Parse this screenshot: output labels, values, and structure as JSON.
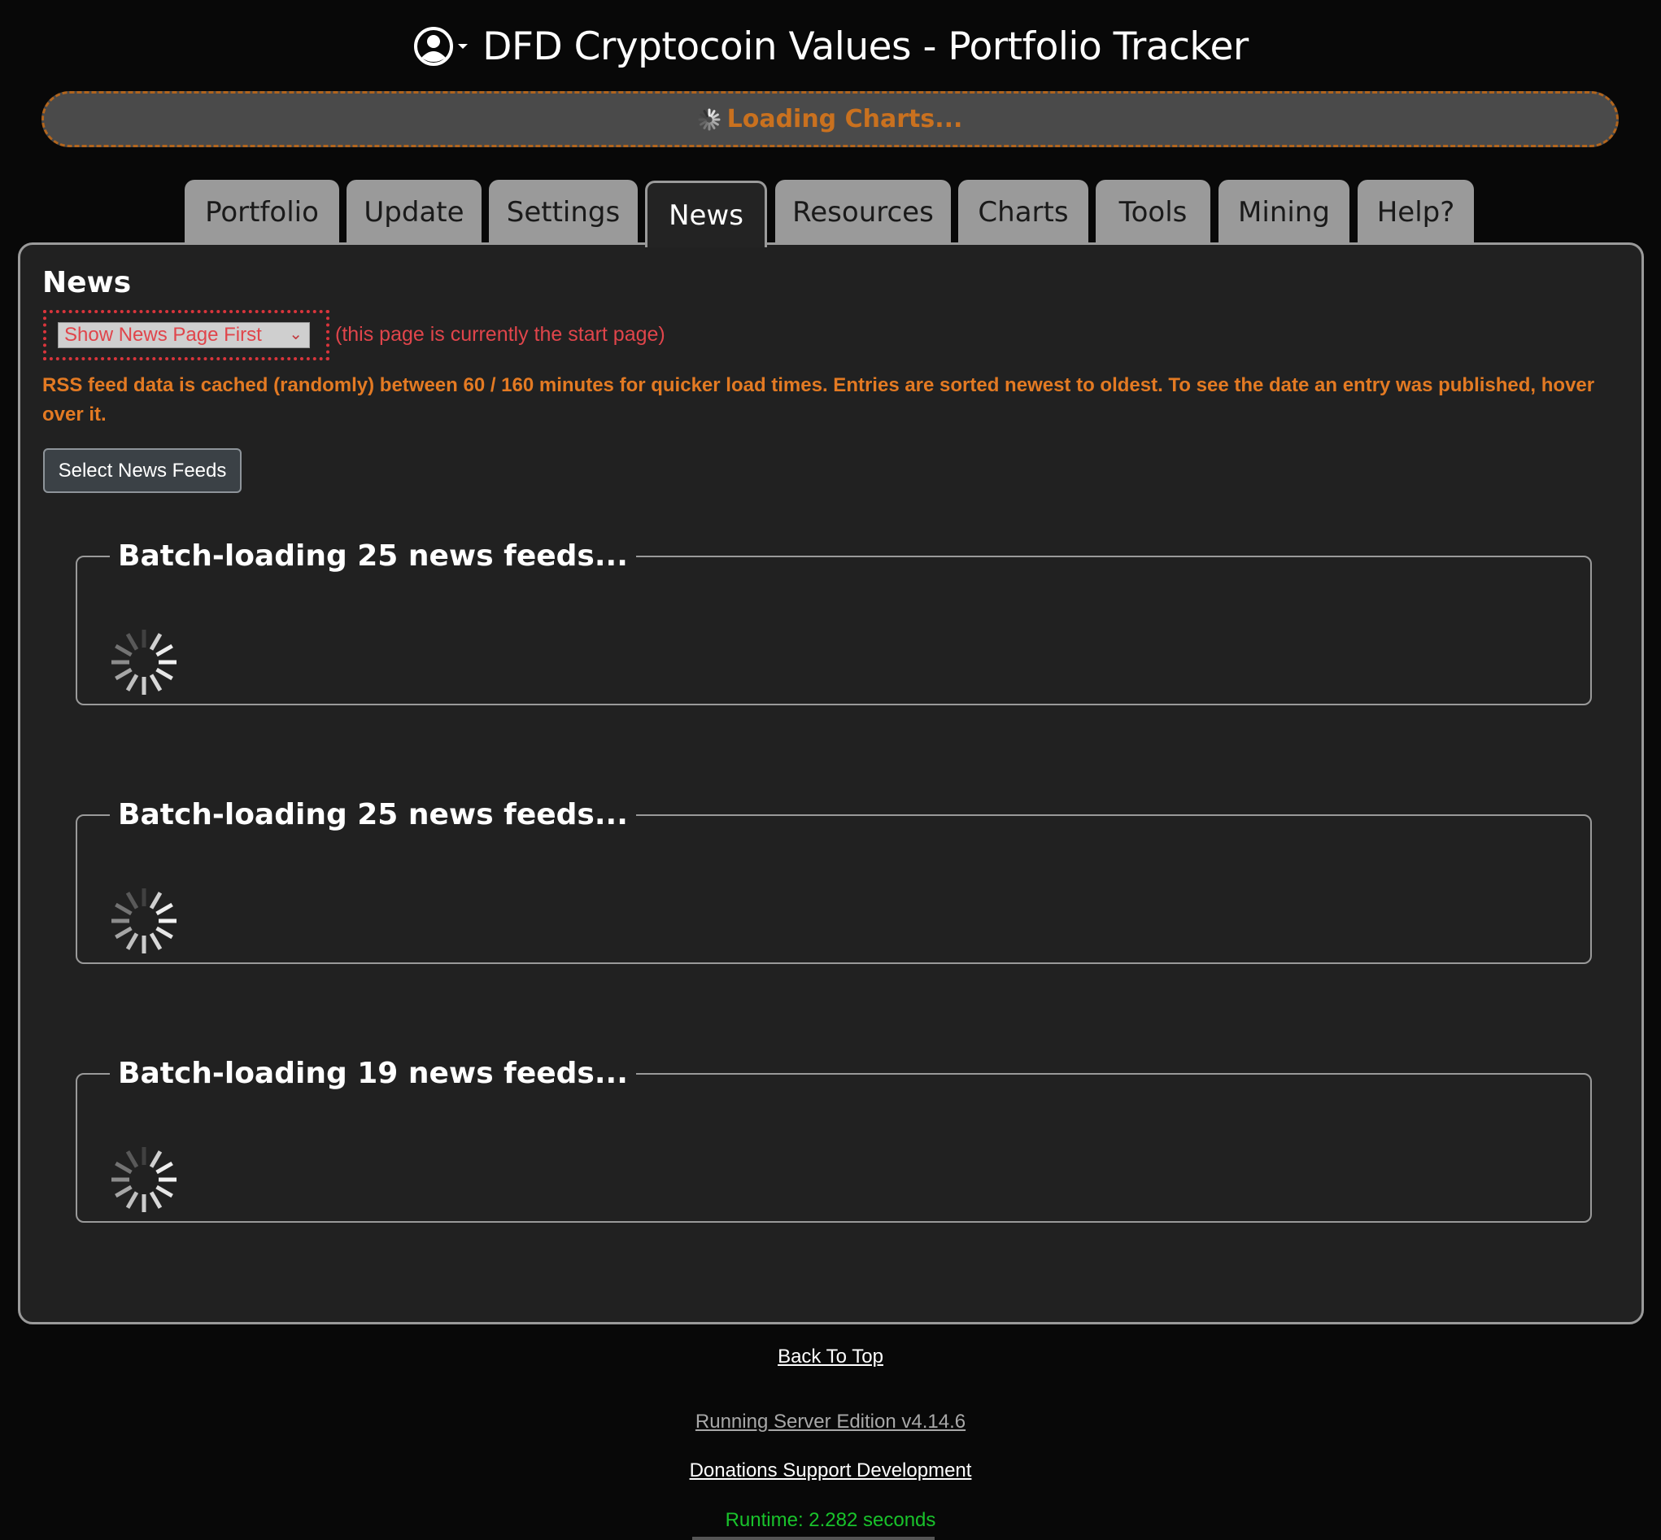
{
  "header": {
    "title": "DFD Cryptocoin Values - Portfolio Tracker",
    "user_icon": "user-circle-icon"
  },
  "loading_bar": {
    "text": "Loading Charts...",
    "color": "#c9711f"
  },
  "tabs": [
    {
      "label": "Portfolio",
      "active": false
    },
    {
      "label": "Update",
      "active": false
    },
    {
      "label": "Settings",
      "active": false
    },
    {
      "label": "News",
      "active": true
    },
    {
      "label": "Resources",
      "active": false
    },
    {
      "label": "Charts",
      "active": false
    },
    {
      "label": "Tools",
      "active": false
    },
    {
      "label": "Mining",
      "active": false
    },
    {
      "label": "Help?",
      "active": false
    }
  ],
  "news": {
    "title": "News",
    "start_page_select": "Show News Page First",
    "start_page_note": "(this page is currently the start page)",
    "info": "RSS feed data is cached (randomly) between 60 / 160 minutes for quicker load times. Entries are sorted newest to oldest. To see the date an entry was published, hover over it.",
    "select_feeds_button": "Select News Feeds",
    "batches": [
      {
        "legend": "Batch-loading 25 news feeds..."
      },
      {
        "legend": "Batch-loading 25 news feeds..."
      },
      {
        "legend": "Batch-loading 19 news feeds..."
      }
    ]
  },
  "footer": {
    "back_to_top": "Back To Top",
    "edition": "Running Server Edition v4.14.6",
    "donations": "Donations Support Development",
    "runtime": "Runtime: 2.282 seconds"
  },
  "colors": {
    "accent_orange": "#e37a23",
    "alert_red": "#e0454b",
    "runtime_green": "#19c22b"
  }
}
